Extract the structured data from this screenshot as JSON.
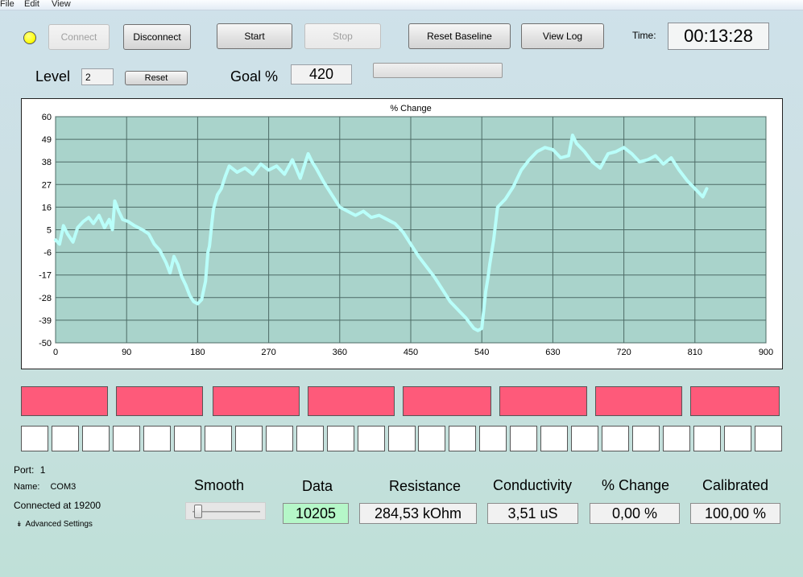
{
  "menu": {
    "file": "File",
    "edit": "Edit",
    "view": "View"
  },
  "toolbar": {
    "connect": "Connect",
    "disconnect": "Disconnect",
    "start": "Start",
    "stop": "Stop",
    "reset_baseline": "Reset Baseline",
    "view_log": "View Log",
    "time_label": "Time:",
    "time_value": "00:13:28",
    "status_led_color": "#ffff00"
  },
  "level": {
    "label": "Level",
    "value": "2",
    "reset": "Reset"
  },
  "goal": {
    "label": "Goal %",
    "value": "420",
    "progress": 0.0
  },
  "chart_data": {
    "type": "line",
    "title": "% Change",
    "xlabel": "",
    "ylabel": "",
    "xlim": [
      0,
      900
    ],
    "ylim": [
      -50,
      60
    ],
    "xticks": [
      0,
      90,
      180,
      270,
      360,
      450,
      540,
      630,
      720,
      810,
      900
    ],
    "yticks": [
      -50,
      -39,
      -28,
      -17,
      -6,
      5,
      16,
      27,
      38,
      49,
      60
    ],
    "grid": true,
    "line_color": "#b9fffa",
    "plot_bg": "#a9d3cb",
    "series": [
      {
        "x": [
          0,
          5,
          10,
          15,
          22,
          28,
          35,
          42,
          48,
          55,
          62,
          68,
          72,
          75,
          80,
          85,
          92,
          100,
          110,
          118,
          125,
          132,
          140,
          145,
          150,
          155,
          160,
          165,
          170,
          175,
          180,
          185,
          190,
          193,
          195,
          198,
          200,
          205,
          210,
          215,
          220,
          230,
          240,
          250,
          260,
          270,
          280,
          290,
          300,
          310,
          320,
          325,
          330,
          340,
          350,
          360,
          370,
          380,
          390,
          400,
          410,
          420,
          430,
          440,
          450,
          460,
          470,
          480,
          490,
          500,
          510,
          520,
          530,
          535,
          540,
          545,
          548,
          550,
          555,
          560,
          570,
          580,
          590,
          600,
          610,
          620,
          630,
          640,
          650,
          655,
          660,
          670,
          680,
          690,
          700,
          710,
          720,
          730,
          740,
          750,
          760,
          770,
          780,
          790,
          800,
          810,
          820,
          825
        ],
        "y": [
          0,
          -2,
          7,
          3,
          -1,
          6,
          9,
          11,
          8,
          12,
          6,
          10,
          5,
          19,
          14,
          10,
          9,
          7,
          5,
          3,
          -2,
          -5,
          -11,
          -16,
          -8,
          -12,
          -18,
          -22,
          -27,
          -30,
          -31,
          -29,
          -20,
          -6,
          -3,
          8,
          15,
          22,
          25,
          31,
          36,
          33,
          35,
          32,
          37,
          34,
          36,
          32,
          39,
          30,
          42,
          38,
          35,
          28,
          22,
          16,
          14,
          12,
          14,
          11,
          12,
          10,
          8,
          4,
          -2,
          -8,
          -13,
          -18,
          -24,
          -30,
          -34,
          -38,
          -43,
          -44,
          -43,
          -25,
          -18,
          -12,
          0,
          16,
          20,
          26,
          34,
          39,
          43,
          45,
          44,
          40,
          41,
          51,
          47,
          43,
          38,
          35,
          42,
          43,
          45,
          42,
          38,
          39,
          41,
          37,
          40,
          34,
          29,
          25,
          21,
          25
        ]
      }
    ]
  },
  "indicators": {
    "red_count": 8,
    "white_count": 25,
    "red_color": "#fe5a7a"
  },
  "port": {
    "port_label": "Port:",
    "port_value": "1",
    "name_label": "Name:",
    "name_value": "COM3",
    "connected": "Connected at 19200",
    "advanced": "Advanced Settings"
  },
  "smooth": {
    "label": "Smooth",
    "value": 0.05
  },
  "readouts": {
    "data_label": "Data",
    "data_value": "10205",
    "resistance_label": "Resistance",
    "resistance_value": "284,53 kOhm",
    "conductivity_label": "Conductivity",
    "conductivity_value": "3,51 uS",
    "change_label": "% Change",
    "change_value": "0,00 %",
    "calibrated_label": "Calibrated",
    "calibrated_value": "100,00 %"
  }
}
